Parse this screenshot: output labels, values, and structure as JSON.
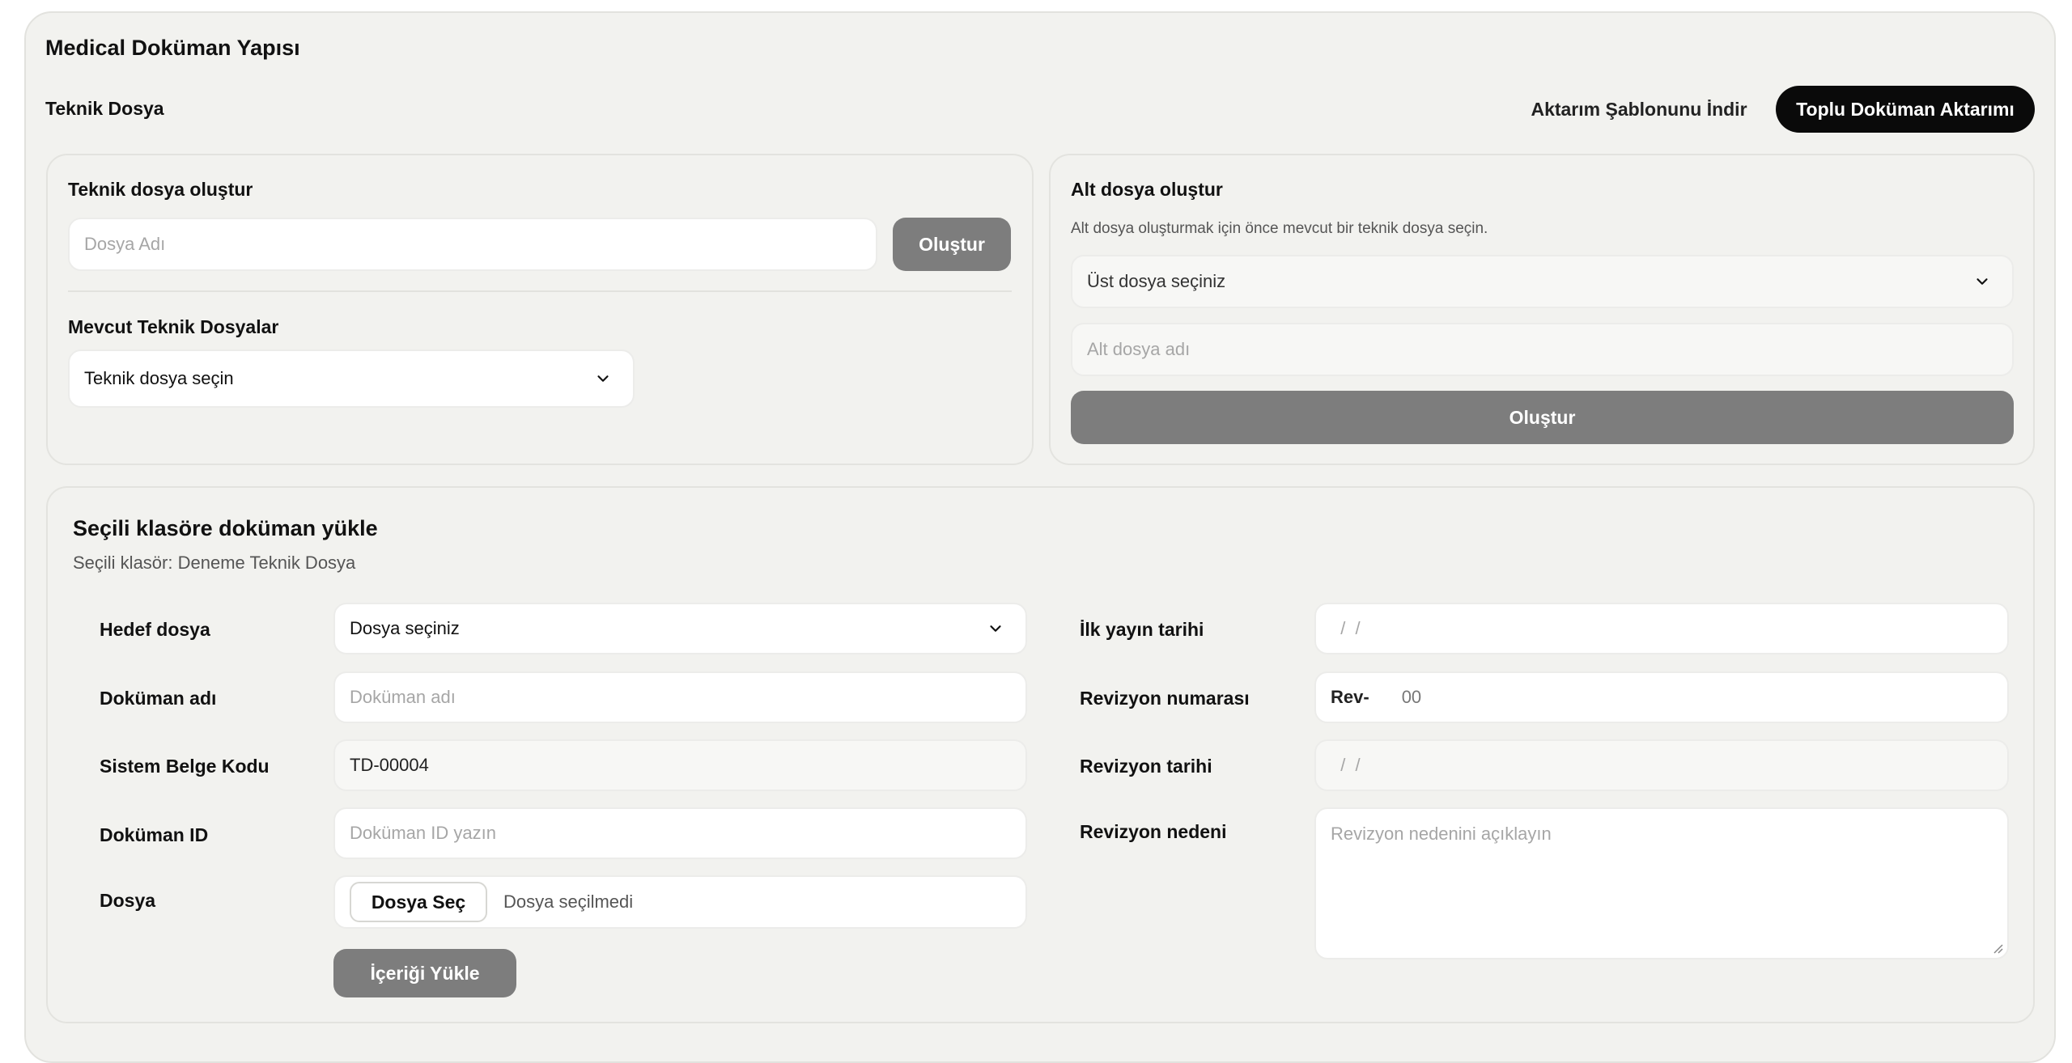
{
  "page": {
    "title": "Medical Doküman Yapısı",
    "section_label": "Teknik Dosya",
    "download_template_label": "Aktarım Şablonunu İndir",
    "bulk_import_label": "Toplu Doküman Aktarımı"
  },
  "create_tech": {
    "title": "Teknik dosya oluştur",
    "name_placeholder": "Dosya Adı",
    "create_button": "Oluştur",
    "existing_title": "Mevcut Teknik Dosyalar",
    "existing_select_value": "Teknik dosya seçin"
  },
  "create_sub": {
    "title": "Alt dosya oluştur",
    "hint": "Alt dosya oluşturmak için önce mevcut bir teknik dosya seçin.",
    "parent_select_value": "Üst dosya seçiniz",
    "sub_name_placeholder": "Alt dosya adı",
    "create_button": "Oluştur"
  },
  "upload": {
    "title": "Seçili klasöre doküman yükle",
    "selected_folder": "Seçili klasör: Deneme Teknik Dosya",
    "target_label": "Hedef dosya",
    "target_value": "Dosya seçiniz",
    "doc_name_label": "Doküman adı",
    "doc_name_placeholder": "Doküman adı",
    "system_code_label": "Sistem Belge Kodu",
    "system_code_value": "TD-00004",
    "doc_id_label": "Doküman ID",
    "doc_id_placeholder": "Doküman ID yazın",
    "file_label": "Dosya",
    "choose_file_button": "Dosya Seç",
    "no_file_text": "Dosya seçilmedi",
    "upload_button": "İçeriği Yükle",
    "first_pub_label": "İlk yayın tarihi",
    "first_pub_value": "  /  /",
    "rev_no_label": "Revizyon numarası",
    "rev_prefix": "Rev-",
    "rev_no_value": "00",
    "rev_date_label": "Revizyon tarihi",
    "rev_date_value": "  /  /",
    "rev_reason_label": "Revizyon nedeni",
    "rev_reason_placeholder": "Revizyon nedenini açıklayın"
  },
  "colors": {
    "page_bg": "#f2f2ef",
    "primary_dark": "#0a0a0a",
    "disabled_button": "#7d7d7d",
    "border": "#e3e3df"
  }
}
